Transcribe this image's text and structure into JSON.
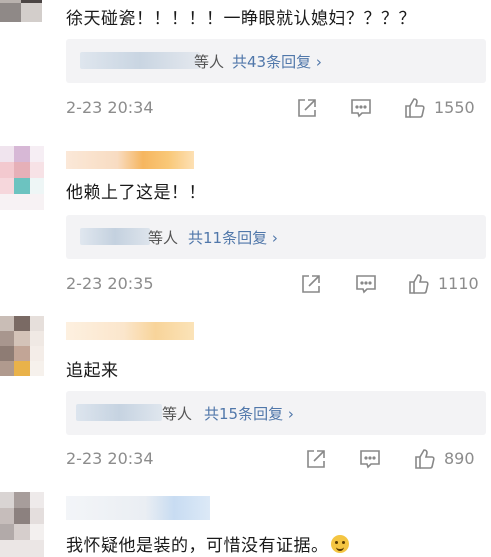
{
  "comments": [
    {
      "text": "徐天碰瓷！！！！！一睁眼就认媳妇？？？？",
      "reply_suffix": "等人",
      "reply_link": "共43条回复 ›",
      "time": "2-23 20:34",
      "likes": "1550"
    },
    {
      "text": "他赖上了这是！！",
      "reply_suffix": "等人",
      "reply_link": "共11条回复 ›",
      "time": "2-23 20:35",
      "likes": "1110"
    },
    {
      "text": "追起来",
      "reply_suffix": "等人",
      "reply_link": "共15条回复 ›",
      "time": "2-23 20:34",
      "likes": "890"
    },
    {
      "text": "我怀疑他是装的，可惜没有证据。"
    }
  ],
  "icons": {
    "share": "share-icon",
    "comment": "comment-icon",
    "like": "thumbs-up-icon",
    "emoji": "smiling-emoji-icon"
  },
  "colors": {
    "link": "#5077aa",
    "meta": "#8c8c8c",
    "reply_bg": "#f3f3f5"
  }
}
